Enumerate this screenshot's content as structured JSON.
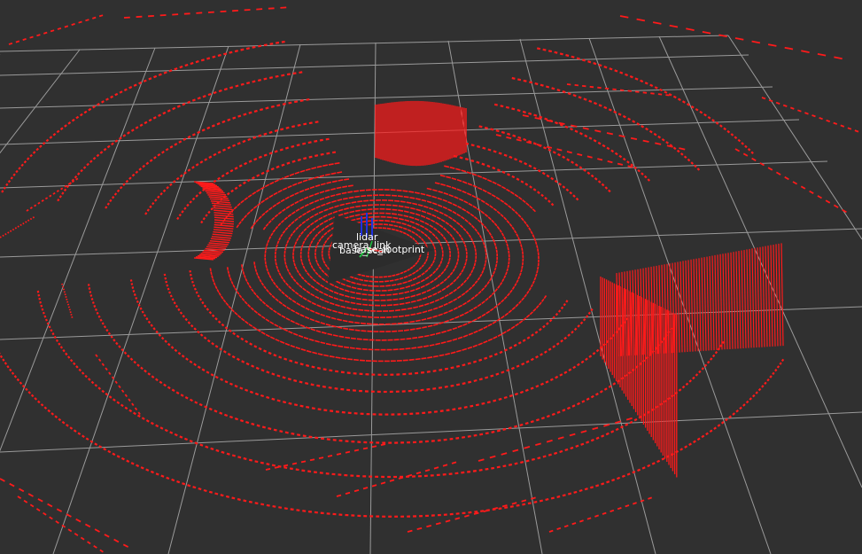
{
  "colors": {
    "background": "#303030",
    "grid": "#9a9a9a",
    "points": "#ff1a1a",
    "axis_x": "#e02020",
    "axis_y": "#20c040",
    "axis_z": "#2030e0"
  },
  "tf_frames": {
    "lidar": "lidar",
    "camera_link": "camera_link",
    "base_scan": "base_scan",
    "base_footprint": "base_footprint"
  }
}
